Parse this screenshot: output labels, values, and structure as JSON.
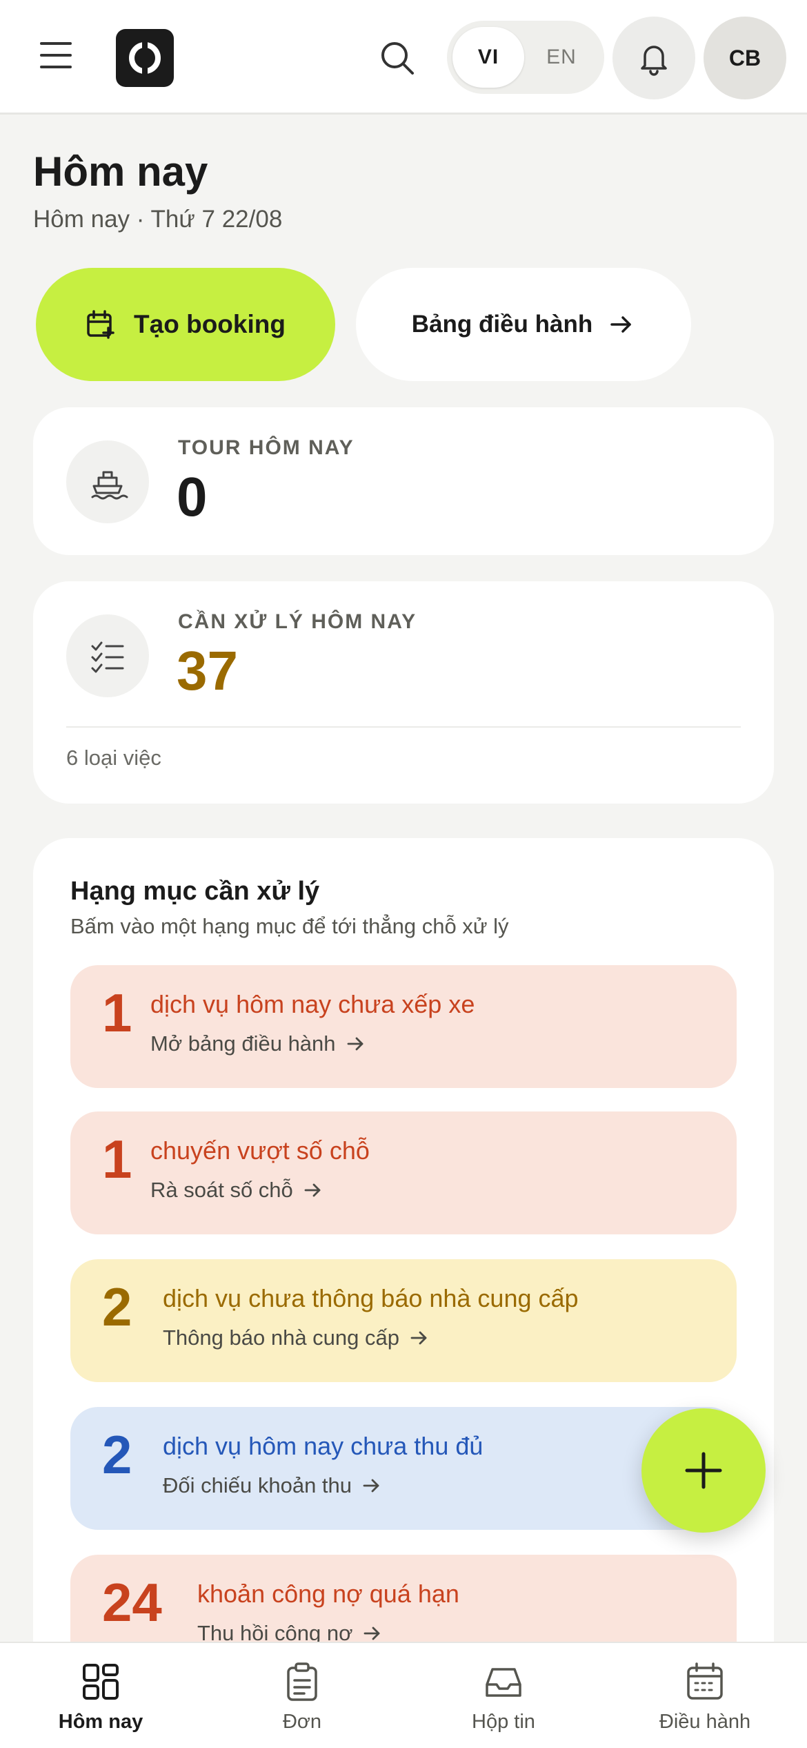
{
  "topbar": {
    "lang": {
      "vi": "VI",
      "en": "EN",
      "selected": "VI"
    },
    "avatar_initials": "CB",
    "icons": [
      "menu-icon",
      "logo",
      "search-icon",
      "bell-icon"
    ]
  },
  "header": {
    "title": "Hôm nay",
    "subtitle": "Hôm nay · Thứ 7 22/08"
  },
  "actions": {
    "create_label": "Tạo booking",
    "board_label": "Bảng điều hành"
  },
  "stats": {
    "tours": {
      "label": "TOUR HÔM NAY",
      "value": "0"
    },
    "todo": {
      "label": "CẦN XỬ LÝ HÔM NAY",
      "value": "37",
      "footer": "6 loại việc",
      "value_color": "#9a6a00"
    }
  },
  "categories": {
    "title": "Hạng mục cần xử lý",
    "subtitle": "Bấm vào một hạng mục để tới thẳng chỗ xử lý",
    "items": [
      {
        "count": "1",
        "title": "dịch vụ hôm nay chưa xếp xe",
        "action": "Mở bảng điều hành",
        "tone": "red",
        "bg": "#fae4dc",
        "fg": "#c8421e"
      },
      {
        "count": "1",
        "title": "chuyến vượt số chỗ",
        "action": "Rà soát số chỗ",
        "tone": "red",
        "bg": "#fae4dc",
        "fg": "#c8421e"
      },
      {
        "count": "2",
        "title": "dịch vụ chưa thông báo nhà cung cấp",
        "action": "Thông báo nhà cung cấp",
        "tone": "amber",
        "bg": "#fbf0c4",
        "fg": "#9a6a00"
      },
      {
        "count": "2",
        "title": "dịch vụ hôm nay chưa thu đủ",
        "action": "Đối chiếu khoản thu",
        "tone": "blue",
        "bg": "#dde8f7",
        "fg": "#2457b8"
      },
      {
        "count": "24",
        "title": "khoản công nợ quá hạn",
        "action": "Thu hồi công nợ",
        "tone": "red",
        "bg": "#fae4dc",
        "fg": "#c8421e"
      }
    ]
  },
  "bottom_nav": {
    "items": [
      {
        "label": "Hôm nay",
        "icon": "grid-icon",
        "active": true
      },
      {
        "label": "Đơn",
        "icon": "clipboard-icon",
        "active": false
      },
      {
        "label": "Hộp tin",
        "icon": "inbox-icon",
        "active": false
      },
      {
        "label": "Điều hành",
        "icon": "calendar-icon",
        "active": false
      }
    ]
  },
  "colors": {
    "accent": "#c6ef41",
    "background": "#f4f4f2"
  }
}
